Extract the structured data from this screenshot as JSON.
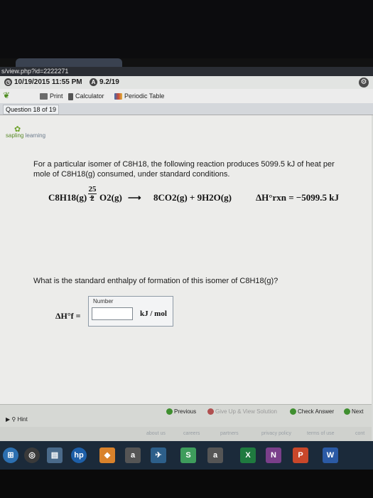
{
  "browser": {
    "tab_title": "",
    "url": "s/view.php?id=2222271"
  },
  "infobar": {
    "datetime": "10/19/2015 11:55 PM",
    "score": "9.2/19"
  },
  "toolbar": {
    "print_label": "Print",
    "calculator_label": "Calculator",
    "periodic_table_label": "Periodic Table"
  },
  "question_counter": "Question 18 of 19",
  "logo": {
    "line1": "sapling",
    "line2": "learning"
  },
  "question": {
    "prompt": "For a particular isomer of C8H18, the following reaction produces 5099.5 kJ of heat per mole of C8H18(g) consumed, under standard conditions.",
    "equation_left": "C8H18(g) +",
    "equation_frac_num": "25",
    "equation_frac_den": "2",
    "equation_o2": "O2(g)",
    "equation_arrow": "⟶",
    "equation_right": "8CO2(g) + 9H2O(g)",
    "enthalpy_rxn": "ΔH°rxn = −5099.5 kJ",
    "ask": "What is the standard enthalpy of formation of this isomer of C8H18(g)?",
    "answer_label": "ΔH°f =",
    "number_label": "Number",
    "answer_value": "",
    "unit": "kJ / mol"
  },
  "nav": {
    "previous": "Previous",
    "give_up": "Give Up & View Solution",
    "check": "Check Answer",
    "next": "Next",
    "hint": "Hint"
  },
  "footer": {
    "links": [
      "about us",
      "careers",
      "partners",
      "privacy policy",
      "terms of use",
      "cont"
    ]
  },
  "taskbar": {
    "items": [
      "hp",
      "a",
      "S",
      "a",
      "X",
      "N",
      "P",
      "W"
    ]
  }
}
